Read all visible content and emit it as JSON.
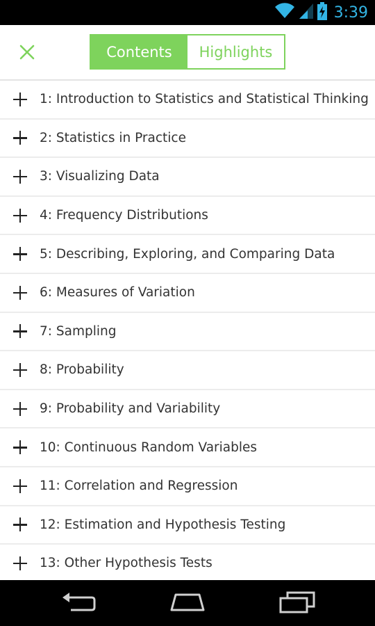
{
  "status_bar": {
    "time": "3:39",
    "wifi_icon": "wifi-icon",
    "signal_icon": "signal-icon",
    "battery_icon": "battery-charging-icon",
    "accent_color": "#33b5e5"
  },
  "header": {
    "close_icon": "close-icon",
    "tabs": [
      {
        "label": "Contents",
        "selected": true
      },
      {
        "label": "Highlights",
        "selected": false
      }
    ],
    "accent_color": "#7ed35c"
  },
  "toc": {
    "expand_icon": "plus-icon",
    "items": [
      {
        "label": "1: Introduction to Statistics and Statistical Thinking"
      },
      {
        "label": "2: Statistics in Practice"
      },
      {
        "label": "3: Visualizing Data"
      },
      {
        "label": "4: Frequency Distributions"
      },
      {
        "label": "5: Describing, Exploring, and Comparing Data"
      },
      {
        "label": "6: Measures of Variation"
      },
      {
        "label": "7: Sampling"
      },
      {
        "label": "8: Probability"
      },
      {
        "label": "9: Probability and Variability"
      },
      {
        "label": "10: Continuous Random Variables"
      },
      {
        "label": "11: Correlation and Regression"
      },
      {
        "label": "12: Estimation and Hypothesis Testing"
      },
      {
        "label": "13: Other Hypothesis Tests"
      }
    ]
  },
  "nav_bar": {
    "back_icon": "back-icon",
    "home_icon": "home-icon",
    "recents_icon": "recent-apps-icon"
  }
}
